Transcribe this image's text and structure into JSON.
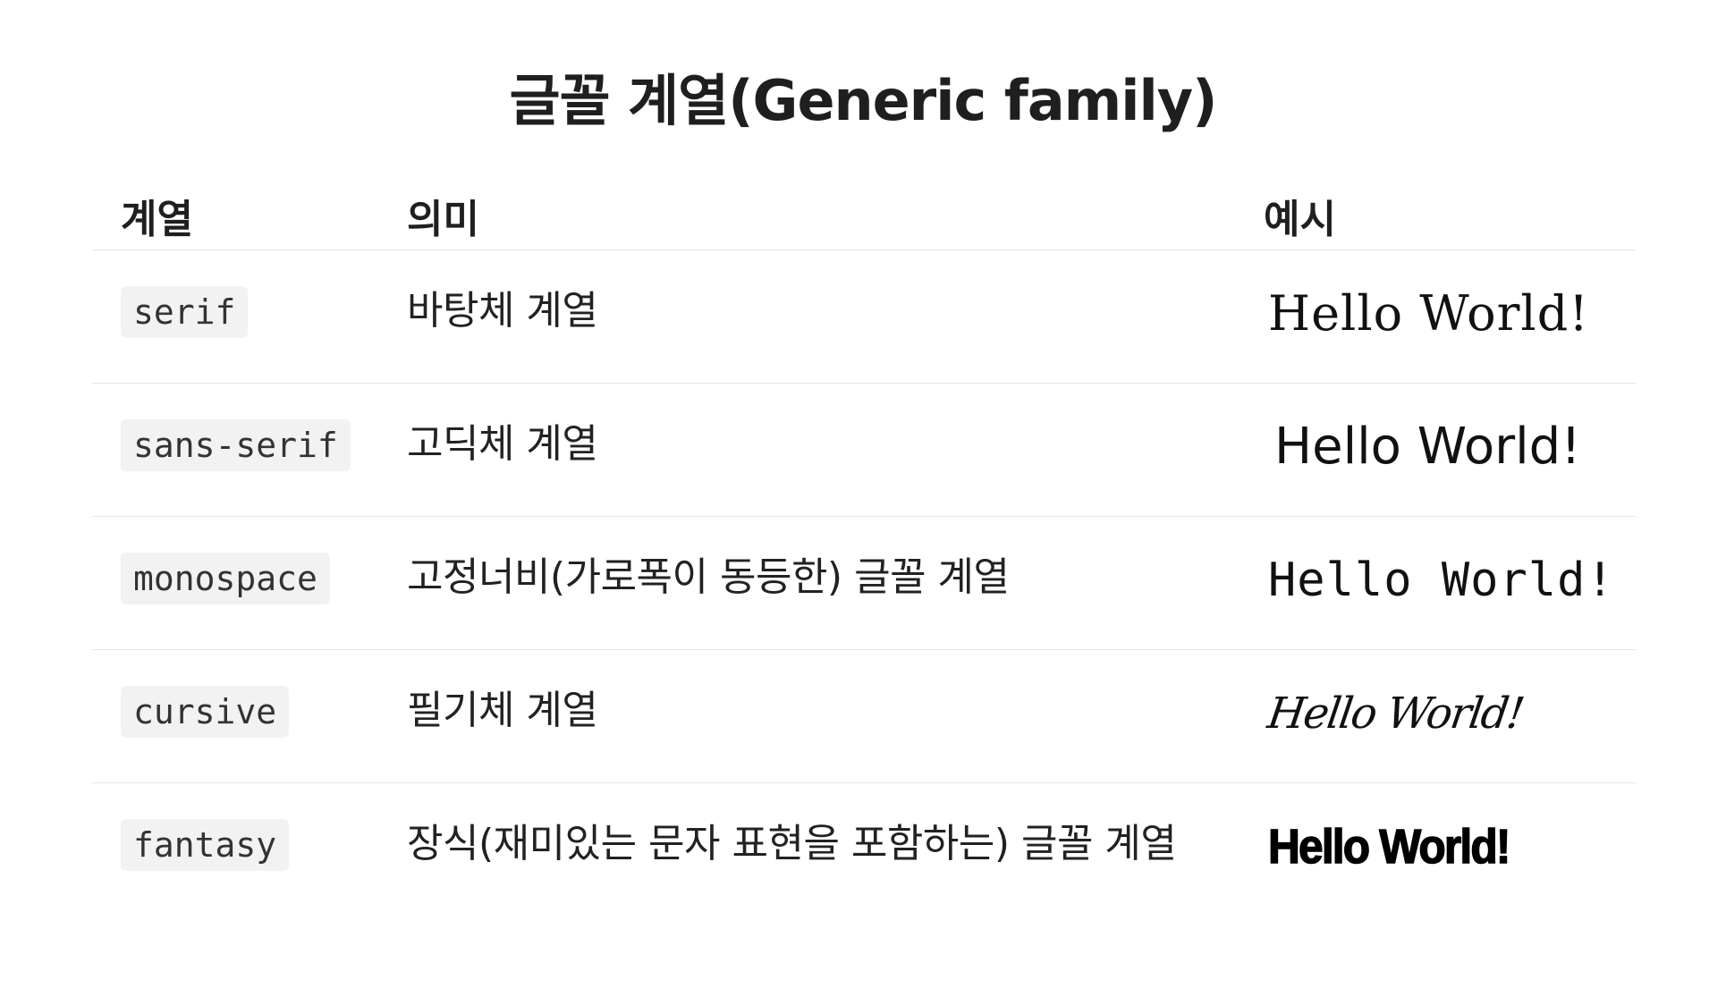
{
  "title": "글꼴 계열(Generic family)",
  "table": {
    "headers": {
      "family": "계열",
      "meaning": "의미",
      "example": "예시"
    },
    "rows": [
      {
        "family": "serif",
        "meaning": "바탕체 계열",
        "example": "Hello World!"
      },
      {
        "family": "sans-serif",
        "meaning": "고딕체 계열",
        "example": "Hello World!"
      },
      {
        "family": "monospace",
        "meaning": "고정너비(가로폭이 동등한) 글꼴 계열",
        "example": "Hello World!"
      },
      {
        "family": "cursive",
        "meaning": "필기체 계열",
        "example": "Hello World!"
      },
      {
        "family": "fantasy",
        "meaning": "장식(재미있는 문자 표현을 포함하는) 글꼴 계열",
        "example": "Hello World!"
      }
    ]
  }
}
